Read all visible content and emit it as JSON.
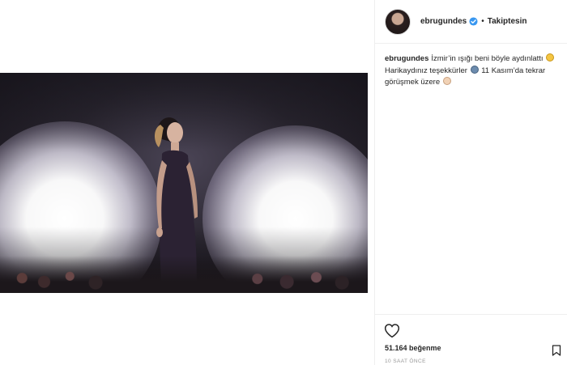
{
  "post": {
    "photo": {
      "description_icon": "concert-photo"
    },
    "header": {
      "username": "ebrugundes",
      "verified_icon": "verified-badge-icon",
      "separator": "•",
      "follow_status": "Takiptesin"
    },
    "caption": {
      "username": "ebrugundes",
      "text_1": "İzmir’in ışığı beni böyle aydınlattı",
      "text_2": "Harikaydınız teşekkürler",
      "text_3": "11 Kasım’da tekrar görüşmek üzere"
    },
    "actions": {
      "like_icon": "heart-icon",
      "save_icon": "bookmark-icon",
      "likes": "51.164 beğenme",
      "timestamp": "10 SAAT ÖNCE"
    }
  },
  "colors": {
    "text": "#262626",
    "muted": "#999999",
    "verified": "#3897f0",
    "divider": "#efefef"
  }
}
